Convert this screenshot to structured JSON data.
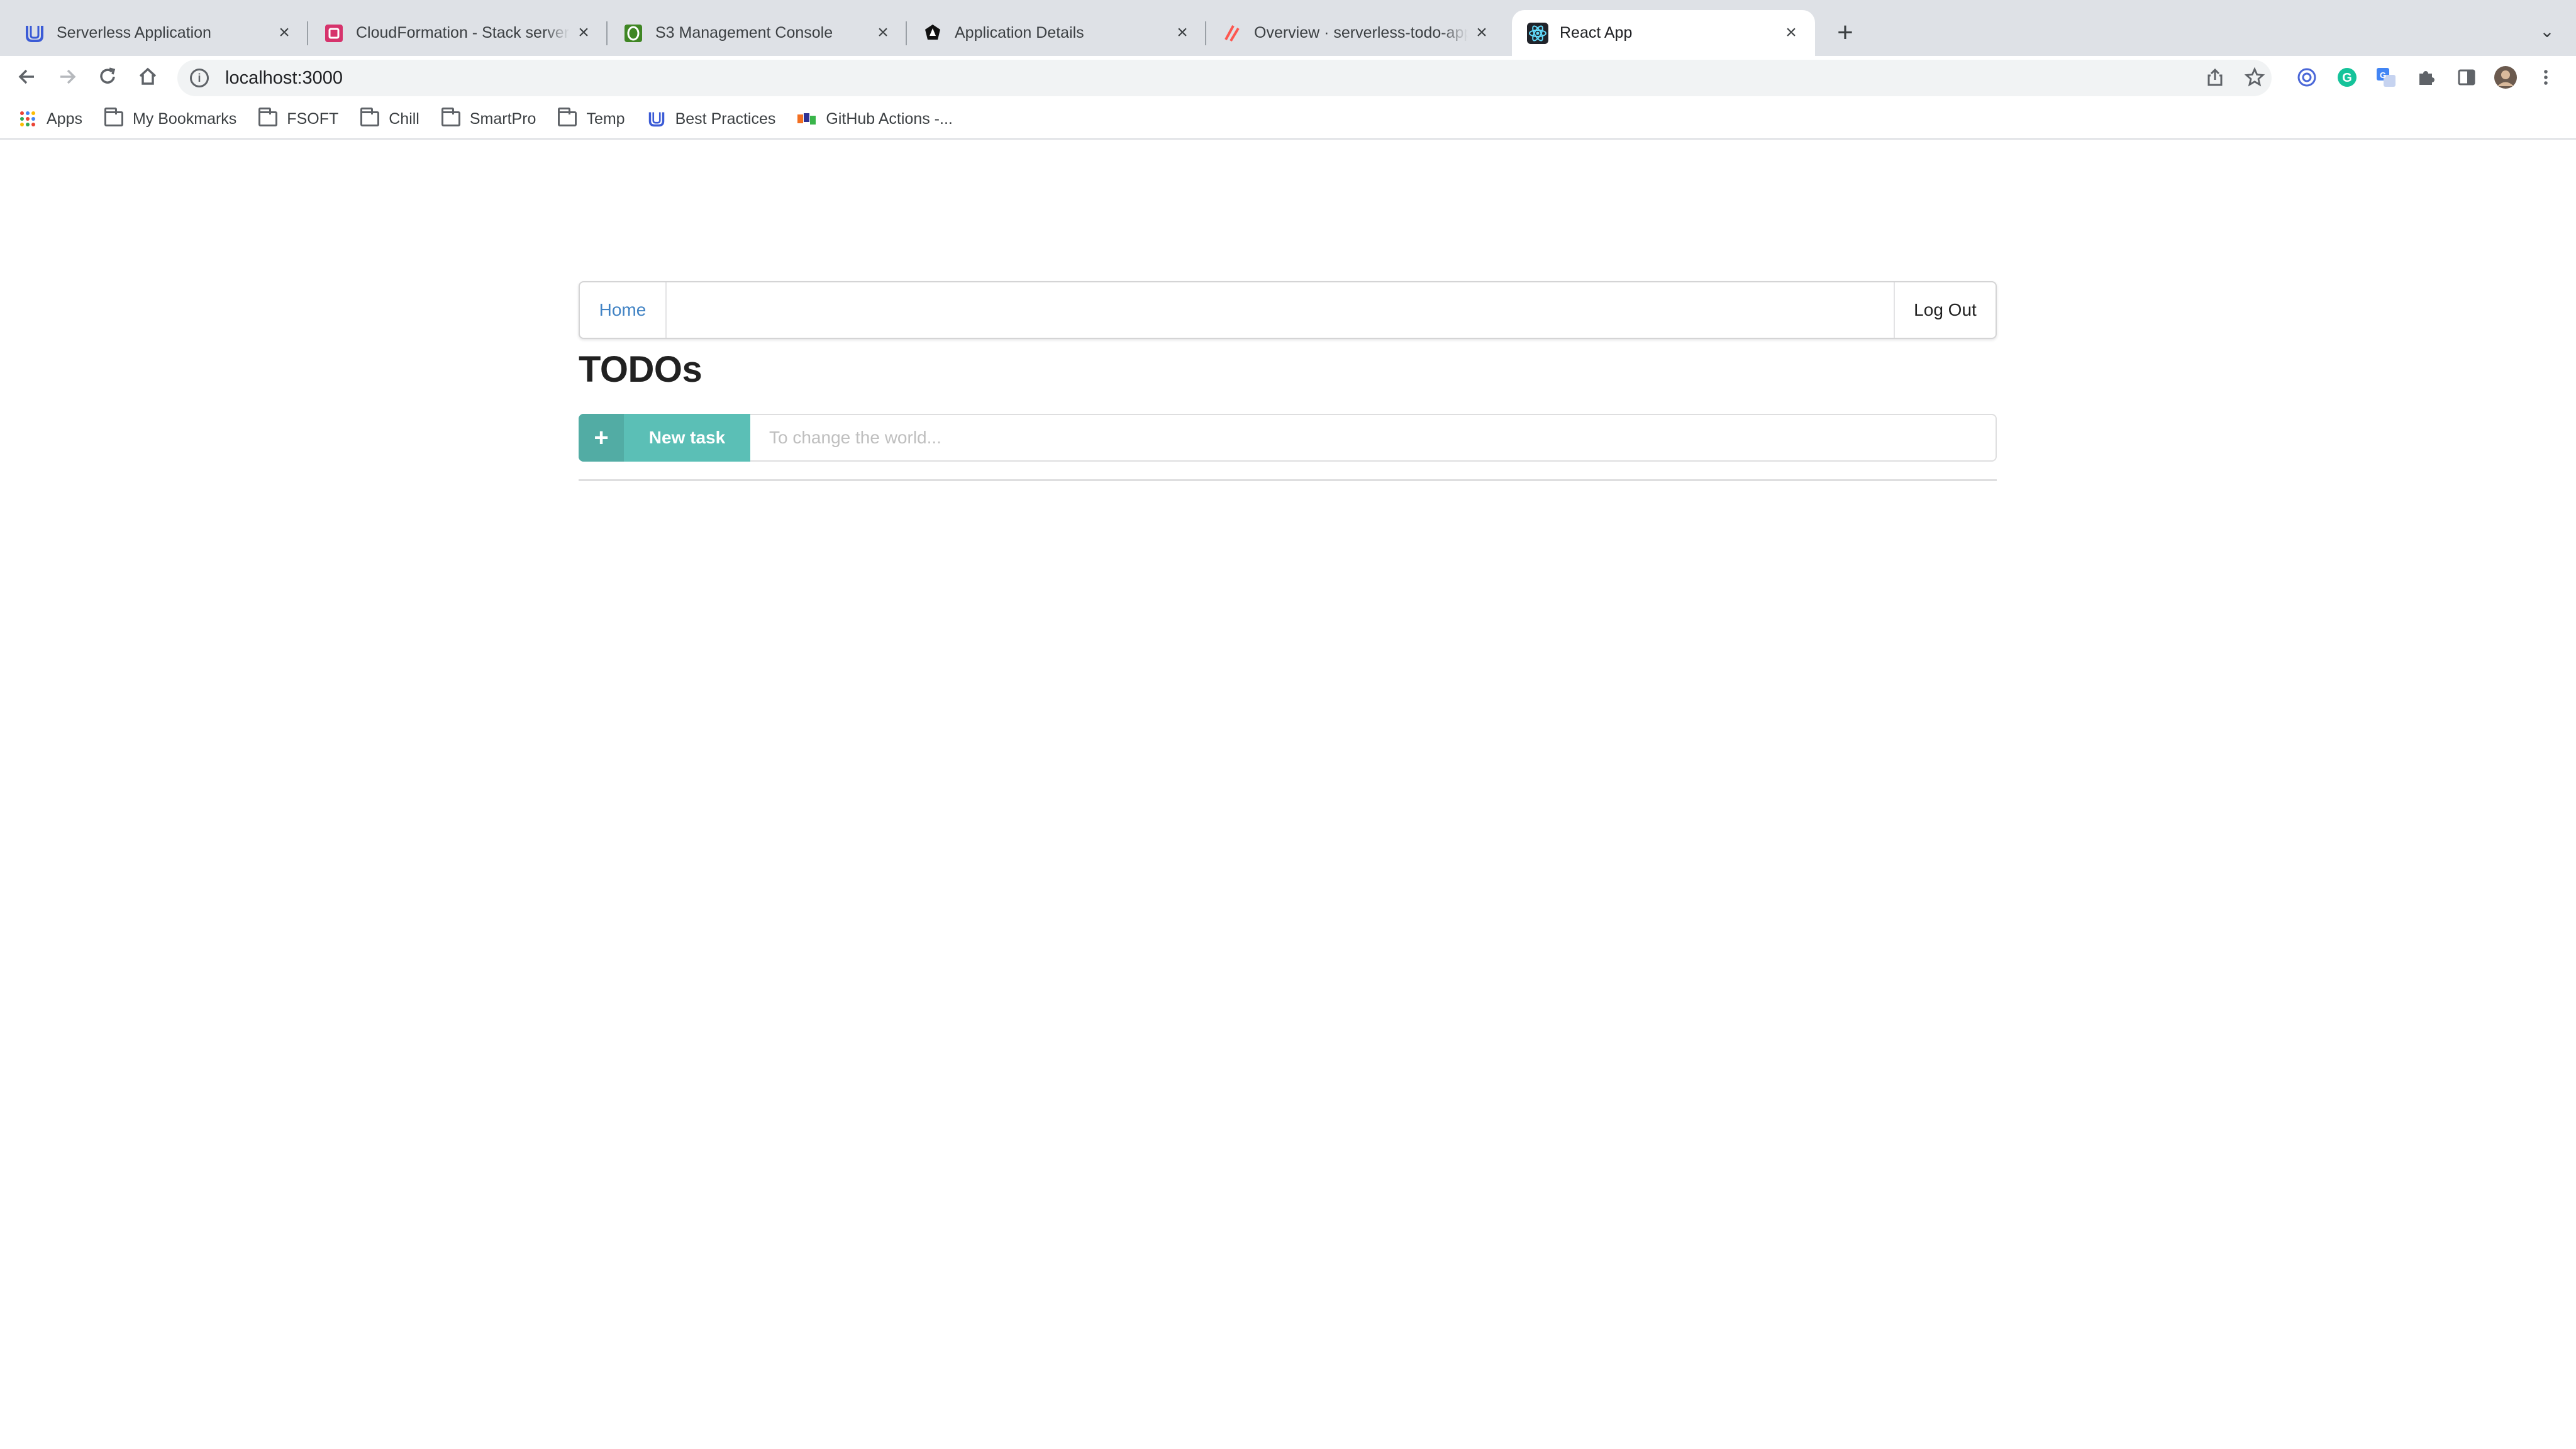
{
  "browser": {
    "tabs": [
      {
        "title": "Serverless Application",
        "icon": "udacity-icon",
        "active": false
      },
      {
        "title": "CloudFormation - Stack serverless",
        "icon": "cloudformation-icon",
        "active": false
      },
      {
        "title": "S3 Management Console",
        "icon": "s3-icon",
        "active": false
      },
      {
        "title": "Application Details",
        "icon": "auth0-icon",
        "active": false
      },
      {
        "title": "Overview · serverless-todo-app",
        "icon": "serverless-icon",
        "active": false
      },
      {
        "title": "React App",
        "icon": "react-icon",
        "active": true
      }
    ],
    "url": "localhost:3000",
    "bookmarks": [
      {
        "label": "Apps",
        "icon": "apps-grid-icon"
      },
      {
        "label": "My Bookmarks",
        "icon": "folder-icon"
      },
      {
        "label": "FSOFT",
        "icon": "folder-icon"
      },
      {
        "label": "Chill",
        "icon": "folder-icon"
      },
      {
        "label": "SmartPro",
        "icon": "folder-icon"
      },
      {
        "label": "Temp",
        "icon": "folder-icon"
      },
      {
        "label": "Best Practices",
        "icon": "udacity-icon"
      },
      {
        "label": "GitHub Actions -...",
        "icon": "fpt-icon"
      }
    ]
  },
  "page": {
    "menu": {
      "home_label": "Home",
      "logout_label": "Log Out"
    },
    "title": "TODOs",
    "new_task": {
      "button_label": "New task",
      "placeholder": "To change the world...",
      "value": ""
    },
    "colors": {
      "accent": "#5bbfb6",
      "link": "#4183c4"
    }
  }
}
